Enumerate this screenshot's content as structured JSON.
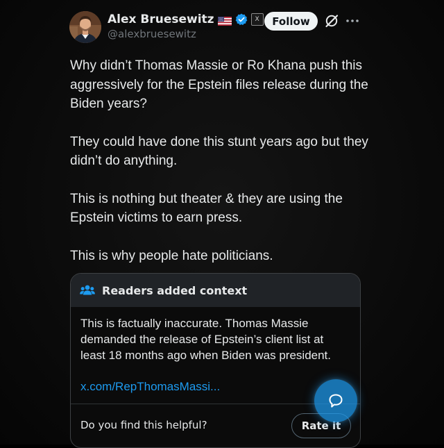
{
  "author": {
    "display_name": "Alex Bruesewitz",
    "handle": "@alexbruesewitz",
    "flag_icon": "us-flag-icon",
    "verified_icon": "verified-badge-icon",
    "affiliate_label": "X",
    "verified_color": "#1d9bf0"
  },
  "header": {
    "follow_label": "Follow",
    "grok_icon": "grok-icon",
    "more_icon": "more-icon"
  },
  "tweet": {
    "paragraphs": [
      "Why didn’t Thomas Massie or Ro Khana push this aggressively for the Epstein files release during the Biden years?",
      "They could have done this stunt years ago but they didn’t do anything.",
      "This is nothing but theater & they are using the Epstein victims to earn press.",
      "This is why people hate politicians."
    ]
  },
  "context": {
    "icon": "readers-group-icon",
    "title": "Readers added context",
    "body": "This is factually inaccurate. Thomas Massie demanded the release of Epstein’s client list at least 18 months ago when Biden was president.",
    "link": "x.com/RepThomasMassi...",
    "helpful_question": "Do you find this helpful?",
    "rate_label": "Rate it",
    "link_color": "#1d9bf0"
  },
  "fab": {
    "icon": "chat-bubble-icon",
    "color": "#1d9bf0"
  }
}
